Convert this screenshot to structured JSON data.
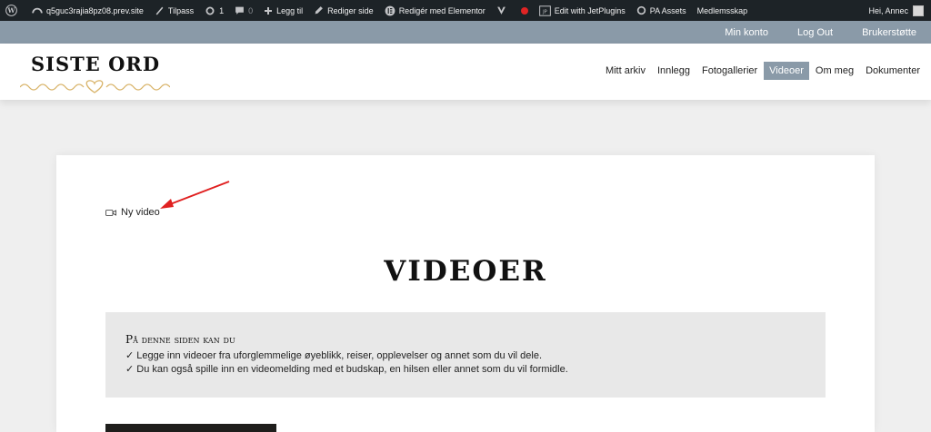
{
  "adminbar": {
    "site": "q5guc3rajia8pz08.prev.site",
    "customize": "Tilpass",
    "updates": "1",
    "comments": "0",
    "new": "Legg til",
    "edit_page": "Rediger side",
    "elementor": "Redigér med Elementor",
    "jetplugins": "Edit with JetPlugins",
    "pa_assets": "PA Assets",
    "membership": "Medlemsskap",
    "greeting": "Hei, Annec"
  },
  "topbar": {
    "links": [
      "Min konto",
      "Log Out",
      "Brukerstøtte"
    ]
  },
  "logo": {
    "text": "SISTE ORD"
  },
  "nav": {
    "items": [
      "Mitt arkiv",
      "Innlegg",
      "Fotogallerier",
      "Videoer",
      "Om meg",
      "Dokumenter"
    ],
    "active": "Videoer"
  },
  "main": {
    "new_video_label": "Ny video",
    "title": "VIDEOER",
    "info": {
      "heading": "På denne siden kan du",
      "lines": [
        "✓  Legge inn videoer fra uforglemmelige øyeblikk, reiser, opplevelser og annet som du vil dele.",
        "✓  Du kan også spille inn en videomelding med et budskap, en hilsen eller annet som du vil formidle."
      ]
    }
  },
  "colors": {
    "adminbar_bg": "#1d2327",
    "topbar_bg": "#8a9aa8",
    "active_nav_bg": "#8a9aa8",
    "arrow": "#e02020",
    "logo_ornament": "#d9b46a"
  }
}
